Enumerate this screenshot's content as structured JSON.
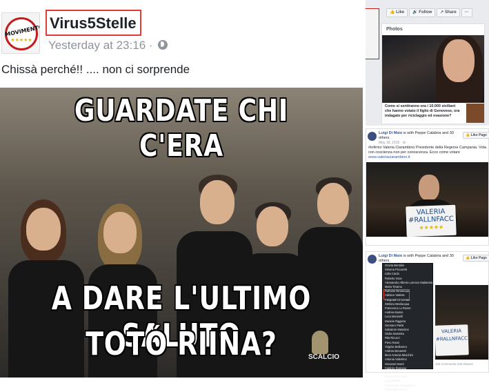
{
  "post": {
    "page_name": "Virus5Stelle",
    "timestamp": "Yesterday at 23:16 ·",
    "caption": "Chissà perché!! .... non ci sorprende",
    "avatar_text": "MOVIMENTO",
    "avatar_stars": "★★★★★",
    "meme": {
      "top_text": "GUARDATE CHI C'ERA",
      "middle_text": "A DARE L'ULTIMO SALUTO",
      "bottom_text": "TOTÓ RIINA?",
      "watermark": "SCALCIO"
    }
  },
  "sidebar": {
    "actions": [
      "👍 Like",
      "🔊 Follow",
      "↗ Share",
      "···"
    ],
    "photos_title": "Photos",
    "photo_caption": "Come si sentiranno ora i 10.000 siciliani che hanno votato il figlio di Genovese, ora indagato per riciclaggio ed evasione?"
  },
  "card2": {
    "author": "Luigi Di Maio",
    "with_text": "is with Peppe Calabria and 30 others.",
    "like_label": "👍 Like Page",
    "date": "May 18, 2015 · ⚙",
    "text": "#iofirmo Valeria Ciarambino Presidente della Regione Campania. Vota con coscienza non per conoscenza. Ecco come votare",
    "link": "www.valeriaciarambino.it",
    "sign_line1": "VALERIA",
    "sign_line2": "#RALLNFACC",
    "sign_stars": "★★★★★"
  },
  "card3": {
    "author": "Luigi Di Maio",
    "with_text": "is with Peppe Calabria and 30 others.",
    "like_label": "👍 Like Page",
    "names": [
      "Grazia Bertolini",
      "Simona Piccoretti",
      "Lidia Cardo",
      "Roberto Voce",
      "Alessandro Alberto Lorenzo Malatesta",
      "Mario Teramo",
      "Raffaele Bevilacqua",
      "Adriano Valente",
      "Pasquale Di Donato",
      "Stefano Bevilacqua",
      "Francesco Lo Rosso",
      "Andrea Musso",
      "Luca Macinelli",
      "Daniele Riggiera",
      "Gennaro Parisi",
      "Salvatore Massimo",
      "Giulia Sammita",
      "Rita Ricucci",
      "Piero Rossi",
      "Virginia Bellonero",
      "Andrea Bonaretti",
      "Ileen Antonia Minichini",
      "Antonia Valentino",
      "Giovanni Morel",
      "Fabrizio Romano",
      "Jenny Pastolivri",
      "Elena Carracciolo",
      "Luca Morelli",
      "Alessandro Sangiuliano",
      "Pasqualino Fiorai"
    ],
    "sign_line1": "VALERIA",
    "sign_line2": "#RALLNFACC",
    "stats": "394 Comments  245 Shares"
  }
}
